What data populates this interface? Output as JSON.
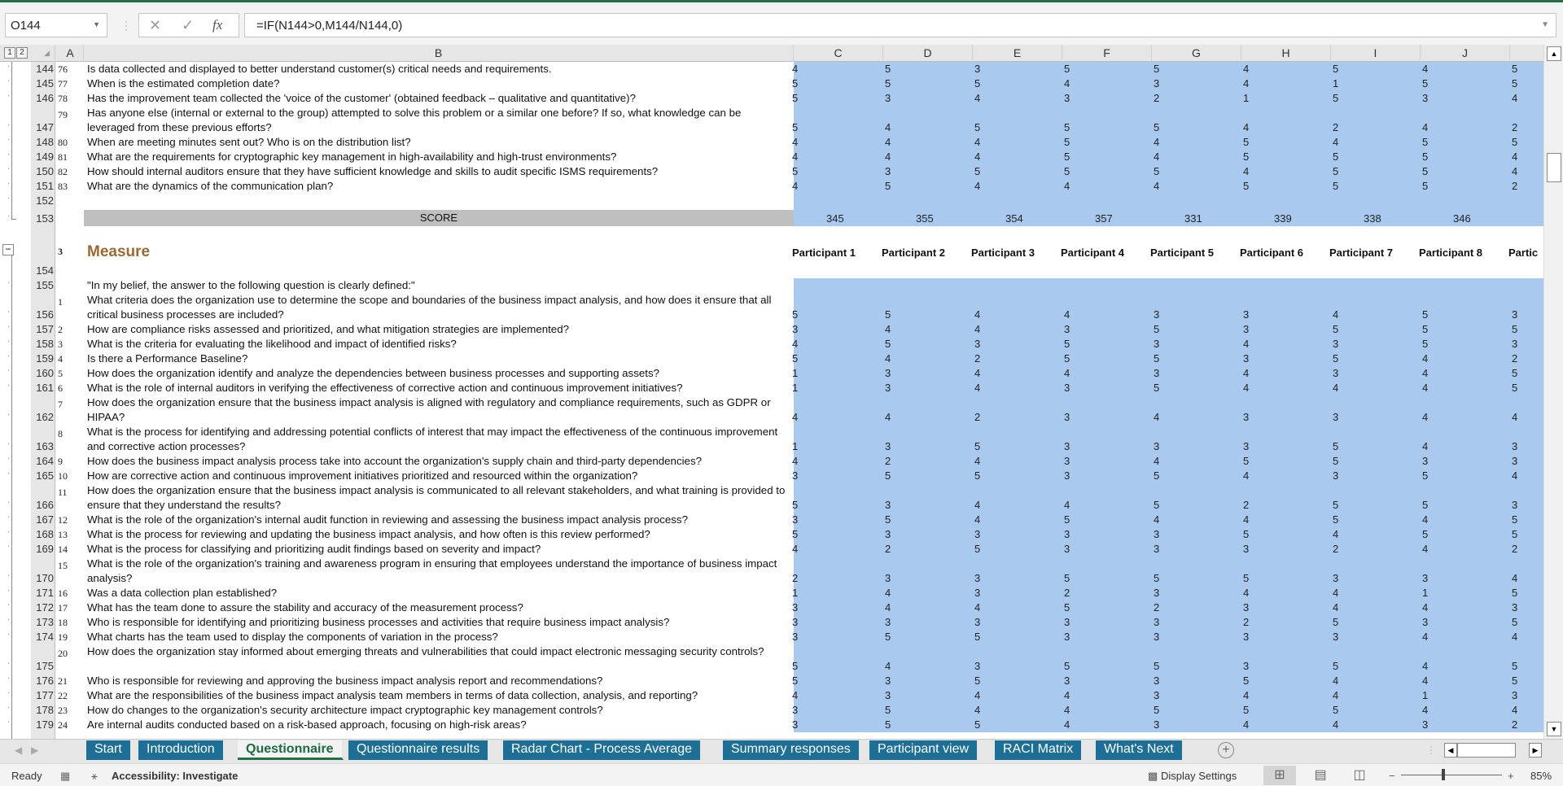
{
  "formula_bar": {
    "name_box": "O144",
    "formula": "=IF(N144>0,M144/N144,0)",
    "cancel_icon": "✕",
    "enter_icon": "✓",
    "fx_label": "fx"
  },
  "outline_levels": [
    "1",
    "2"
  ],
  "columns": [
    "A",
    "B",
    "C",
    "D",
    "E",
    "F",
    "G",
    "H",
    "I",
    "J"
  ],
  "section1": {
    "rows": [
      {
        "row": "144",
        "num": "76",
        "text": "Is data collected and displayed to better understand customer(s) critical needs and requirements.",
        "values": [
          4,
          5,
          3,
          5,
          5,
          4,
          5,
          4,
          5
        ]
      },
      {
        "row": "145",
        "num": "77",
        "text": "When is the estimated completion date?",
        "values": [
          5,
          5,
          5,
          4,
          3,
          4,
          1,
          5,
          5
        ]
      },
      {
        "row": "146",
        "num": "78",
        "text": "Has the improvement team collected the 'voice of the customer' (obtained feedback – qualitative and quantitative)?",
        "values": [
          5,
          3,
          4,
          3,
          2,
          1,
          5,
          3,
          4
        ]
      },
      {
        "row": "147",
        "num": "79",
        "text": "Has anyone else (internal or external to the group) attempted to solve this problem or a similar one before? If so, what knowledge can be leveraged from these previous efforts?",
        "values": [
          5,
          4,
          5,
          5,
          5,
          4,
          2,
          4,
          2
        ]
      },
      {
        "row": "148",
        "num": "80",
        "text": "When are meeting minutes sent out? Who is on the distribution list?",
        "values": [
          4,
          4,
          4,
          5,
          4,
          5,
          4,
          5,
          5
        ]
      },
      {
        "row": "149",
        "num": "81",
        "text": "What are the requirements for cryptographic key management in high-availability and high-trust environments?",
        "values": [
          4,
          4,
          4,
          5,
          4,
          5,
          5,
          5,
          4
        ]
      },
      {
        "row": "150",
        "num": "82",
        "text": "How should internal auditors ensure that they have sufficient knowledge and skills to audit specific ISMS requirements?",
        "values": [
          5,
          3,
          5,
          5,
          5,
          4,
          5,
          5,
          4
        ]
      },
      {
        "row": "151",
        "num": "83",
        "text": "What are the dynamics of the communication plan?",
        "values": [
          4,
          5,
          4,
          4,
          4,
          5,
          5,
          5,
          2
        ]
      }
    ],
    "blank_row": "152",
    "score_row": "153",
    "score_label": "SCORE",
    "scores": [
      345,
      355,
      354,
      357,
      331,
      339,
      338,
      346
    ]
  },
  "section2": {
    "outline_row_num": "3",
    "title": "Measure",
    "title_row": "154",
    "participants": [
      "Participant 1",
      "Participant 2",
      "Participant 3",
      "Participant 4",
      "Participant 5",
      "Participant 6",
      "Participant 7",
      "Participant 8",
      "Partic"
    ],
    "intro_row": "155",
    "intro": "\"In my belief, the answer to the following question is clearly defined:\"",
    "rows": [
      {
        "row": "156",
        "num": "1",
        "text": "What criteria does the organization use to determine the scope and boundaries of the business impact analysis, and how does it ensure that all critical business processes are included?",
        "values": [
          5,
          5,
          4,
          4,
          3,
          3,
          4,
          5,
          3
        ]
      },
      {
        "row": "157",
        "num": "2",
        "text": "How are compliance risks assessed and prioritized, and what mitigation strategies are implemented?",
        "values": [
          3,
          4,
          4,
          3,
          5,
          3,
          5,
          5,
          5
        ]
      },
      {
        "row": "158",
        "num": "3",
        "text": "What is the criteria for evaluating the likelihood and impact of identified risks?",
        "values": [
          4,
          5,
          3,
          5,
          3,
          4,
          3,
          5,
          3
        ]
      },
      {
        "row": "159",
        "num": "4",
        "text": "Is there a Performance Baseline?",
        "values": [
          5,
          4,
          2,
          5,
          5,
          3,
          5,
          4,
          2
        ]
      },
      {
        "row": "160",
        "num": "5",
        "text": "How does the organization identify and analyze the dependencies between business processes and supporting assets?",
        "values": [
          1,
          3,
          4,
          4,
          3,
          4,
          3,
          4,
          5
        ]
      },
      {
        "row": "161",
        "num": "6",
        "text": "What is the role of internal auditors in verifying the effectiveness of corrective action and continuous improvement initiatives?",
        "values": [
          1,
          3,
          4,
          3,
          5,
          4,
          4,
          4,
          5
        ]
      },
      {
        "row": "162",
        "num": "7",
        "text": "How does the organization ensure that the business impact analysis is aligned with regulatory and compliance requirements, such as GDPR or HIPAA?",
        "values": [
          4,
          4,
          2,
          3,
          4,
          3,
          3,
          4,
          4
        ]
      },
      {
        "row": "163",
        "num": "8",
        "text": "What is the process for identifying and addressing potential conflicts of interest that may impact the effectiveness of the continuous improvement and corrective action processes?",
        "values": [
          1,
          3,
          5,
          3,
          3,
          3,
          5,
          4,
          3
        ]
      },
      {
        "row": "164",
        "num": "9",
        "text": "How does the business impact analysis process take into account the organization's supply chain and third-party dependencies?",
        "values": [
          4,
          2,
          4,
          3,
          4,
          5,
          5,
          3,
          3
        ]
      },
      {
        "row": "165",
        "num": "10",
        "text": "How are corrective action and continuous improvement initiatives prioritized and resourced within the organization?",
        "values": [
          3,
          5,
          5,
          3,
          5,
          4,
          3,
          5,
          4
        ]
      },
      {
        "row": "166",
        "num": "11",
        "text": "How does the organization ensure that the business impact analysis is communicated to all relevant stakeholders, and what training is provided to ensure that they understand the results?",
        "values": [
          5,
          3,
          4,
          4,
          5,
          2,
          5,
          5,
          3
        ]
      },
      {
        "row": "167",
        "num": "12",
        "text": "What is the role of the organization's internal audit function in reviewing and assessing the business impact analysis process?",
        "values": [
          3,
          5,
          4,
          5,
          4,
          4,
          5,
          4,
          5
        ]
      },
      {
        "row": "168",
        "num": "13",
        "text": "What is the process for reviewing and updating the business impact analysis, and how often is this review performed?",
        "values": [
          5,
          3,
          3,
          3,
          3,
          5,
          4,
          5,
          5
        ]
      },
      {
        "row": "169",
        "num": "14",
        "text": "What is the process for classifying and prioritizing audit findings based on severity and impact?",
        "values": [
          4,
          2,
          5,
          3,
          3,
          3,
          2,
          4,
          2
        ]
      },
      {
        "row": "170",
        "num": "15",
        "text": "What is the role of the organization's training and awareness program in ensuring that employees understand the importance of business impact analysis?",
        "values": [
          2,
          3,
          3,
          5,
          5,
          5,
          3,
          3,
          4
        ]
      },
      {
        "row": "171",
        "num": "16",
        "text": "Was a data collection plan established?",
        "values": [
          1,
          4,
          3,
          2,
          3,
          4,
          4,
          1,
          5
        ]
      },
      {
        "row": "172",
        "num": "17",
        "text": "What has the team done to assure the stability and accuracy of the measurement process?",
        "values": [
          3,
          4,
          4,
          5,
          2,
          3,
          4,
          4,
          3
        ]
      },
      {
        "row": "173",
        "num": "18",
        "text": "Who is responsible for identifying and prioritizing business processes and activities that require business impact analysis?",
        "values": [
          3,
          3,
          3,
          3,
          3,
          2,
          5,
          3,
          5
        ]
      },
      {
        "row": "174",
        "num": "19",
        "text": "What charts has the team used to display the components of variation in the process?",
        "values": [
          3,
          5,
          5,
          3,
          3,
          3,
          3,
          4,
          4
        ]
      },
      {
        "row": "175",
        "num": "20",
        "text": "How does the organization stay informed about emerging threats and vulnerabilities that could impact electronic messaging security controls?",
        "values": [
          5,
          4,
          3,
          5,
          5,
          3,
          5,
          4,
          5
        ]
      },
      {
        "row": "176",
        "num": "21",
        "text": "Who is responsible for reviewing and approving the business impact analysis report and recommendations?",
        "values": [
          5,
          3,
          5,
          3,
          3,
          5,
          4,
          4,
          5
        ]
      },
      {
        "row": "177",
        "num": "22",
        "text": "What are the responsibilities of the business impact analysis team members in terms of data collection, analysis, and reporting?",
        "values": [
          4,
          3,
          4,
          4,
          3,
          4,
          4,
          1,
          3
        ]
      },
      {
        "row": "178",
        "num": "23",
        "text": "How do changes to the organization's security architecture impact cryptographic key management controls?",
        "values": [
          3,
          5,
          4,
          4,
          5,
          5,
          5,
          4,
          4
        ]
      },
      {
        "row": "179",
        "num": "24",
        "text": "Are internal audits conducted based on a risk-based approach, focusing on high-risk areas?",
        "values": [
          3,
          5,
          5,
          4,
          3,
          4,
          4,
          3,
          2
        ]
      }
    ]
  },
  "sheet_tabs": [
    {
      "label": "Start",
      "active": false
    },
    {
      "label": "Introduction",
      "active": false
    },
    {
      "label": "Questionnaire",
      "active": true
    },
    {
      "label": "Questionnaire results",
      "active": false
    },
    {
      "label": "Radar Chart - Process Average",
      "active": false
    },
    {
      "label": "Summary responses",
      "active": false
    },
    {
      "label": "Participant view",
      "active": false
    },
    {
      "label": "RACI Matrix",
      "active": false
    },
    {
      "label": "What's Next",
      "active": false
    }
  ],
  "status_bar": {
    "ready": "Ready",
    "accessibility": "Accessibility: Investigate",
    "display_settings": "Display Settings",
    "zoom": "85%",
    "zoom_percent": 85
  },
  "colors": {
    "excel_green": "#217346",
    "cell_blue": "#a9caee",
    "tab_blue": "#1d6f95",
    "measure_brown": "#9c6a31",
    "score_gray": "#bfbfbf"
  }
}
